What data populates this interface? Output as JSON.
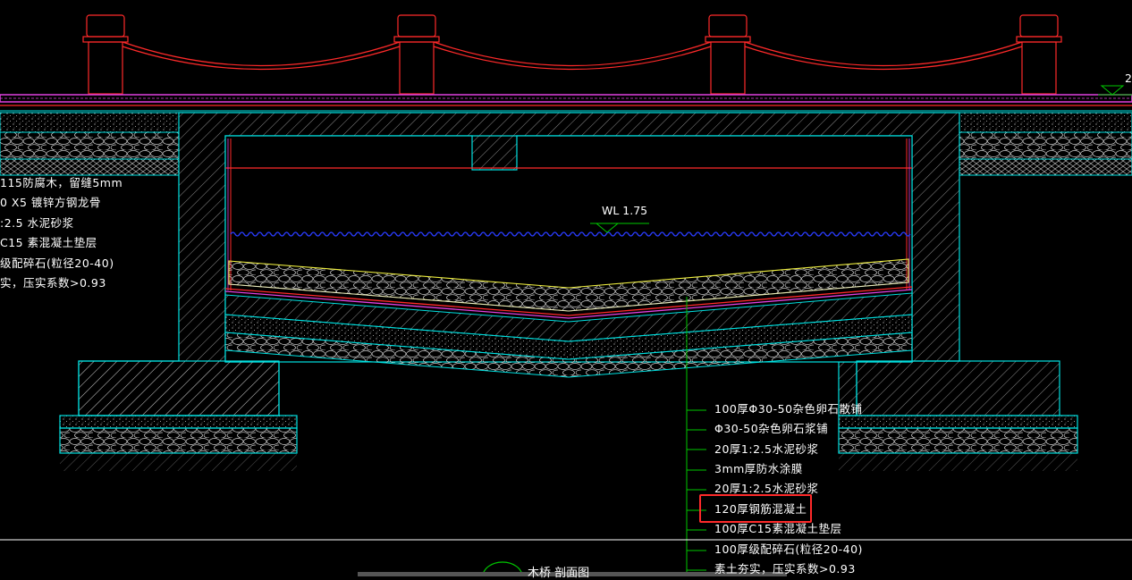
{
  "drawing": {
    "water_level": "WL 1.75",
    "top_right_mark": "2",
    "left_notes": [
      "115防腐木，留缝5mm",
      "0 X5 镀锌方钢龙骨",
      ":2.5 水泥砂浆",
      "C15 素混凝土垫层",
      "级配碎石(粒径20-40)",
      "实，压实系数>0.93"
    ],
    "layer_callouts": [
      "100厚Φ30-50杂色卵石散铺",
      "Φ30-50杂色卵石浆铺",
      "20厚1:2.5水泥砂浆",
      "3mm厚防水涂膜",
      "20厚1:2.5水泥砂浆",
      "120厚钢筋混凝土",
      "100厚C15素混凝土垫层",
      "100厚级配碎石(粒径20-40)",
      "素土夯实，压实系数>0.93"
    ],
    "highlighted_callout_index": 5,
    "title": "木桥 剖面图",
    "colors": {
      "background": "#000000",
      "railing": "#ff2a2a",
      "structure": "#00e0e0",
      "deck": "#e040e0",
      "water": "#2a3cff",
      "gravel_top": "#f0f040",
      "leader": "#00c800",
      "highlight": "#ff2a2a"
    }
  }
}
